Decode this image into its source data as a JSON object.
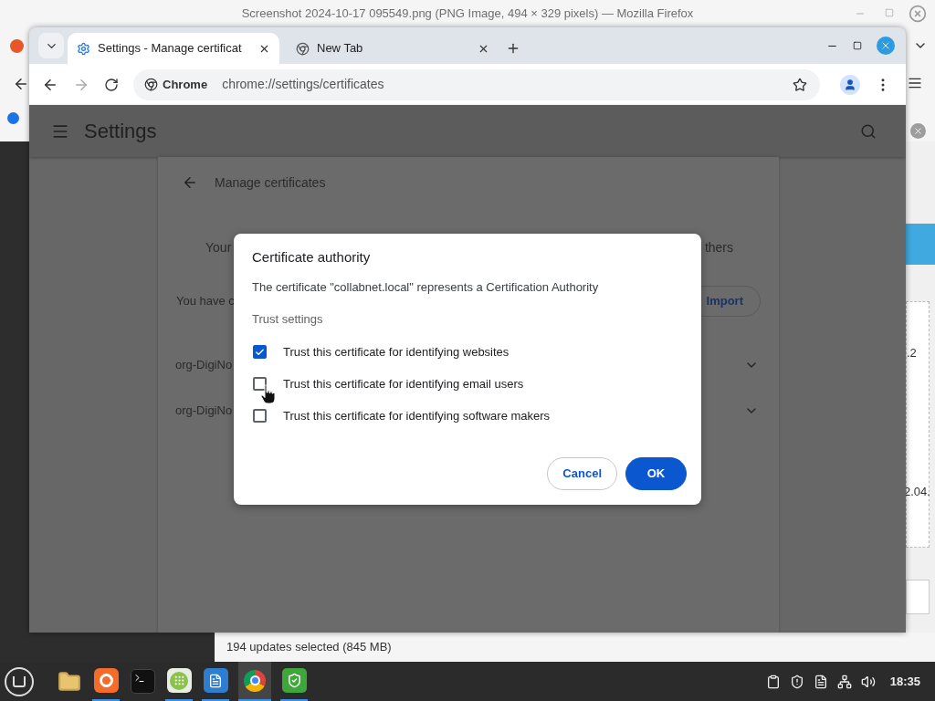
{
  "firefox_window": {
    "title": "Screenshot 2024-10-17 095549.png (PNG Image, 494 × 329 pixels) — Mozilla Firefox"
  },
  "background_window": {
    "column_texts": [
      ".2",
      "2.04."
    ],
    "status": "194 updates selected (845 MB)"
  },
  "browser": {
    "tabs": [
      {
        "title": "Settings - Manage certificat",
        "selected": true
      },
      {
        "title": "New Tab",
        "selected": false
      }
    ],
    "site_chip": "Chrome",
    "url": "chrome://settings/certificates"
  },
  "settings": {
    "title": "Settings",
    "page_title": "Manage certificates",
    "tab_row_start": "Your",
    "tab_row_end": "thers",
    "count_text": "You have c",
    "import_button": "Import",
    "certificates": [
      "org-DigiNo",
      "org-DigiNo"
    ]
  },
  "dialog": {
    "title": "Certificate authority",
    "message": "The certificate \"collabnet.local\" represents a Certification Authority",
    "section": "Trust settings",
    "options": [
      {
        "label": "Trust this certificate for identifying websites",
        "checked": true
      },
      {
        "label": "Trust this certificate for identifying email users",
        "checked": false
      },
      {
        "label": "Trust this certificate for identifying software makers",
        "checked": false
      }
    ],
    "buttons": [
      {
        "label": "Cancel",
        "kind": "secondary"
      },
      {
        "label": "OK",
        "kind": "primary"
      }
    ]
  },
  "taskbar": {
    "clock": "18:35"
  }
}
